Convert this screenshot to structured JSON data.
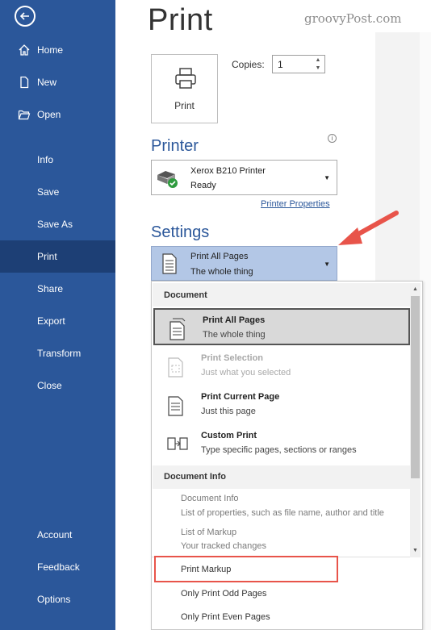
{
  "watermark": "groovyPost.com",
  "sidebar": {
    "top_items": [
      {
        "label": "Home",
        "icon": "home-icon"
      },
      {
        "label": "New",
        "icon": "new-document-icon"
      },
      {
        "label": "Open",
        "icon": "folder-open-icon"
      }
    ],
    "items": [
      {
        "label": "Info"
      },
      {
        "label": "Save"
      },
      {
        "label": "Save As"
      },
      {
        "label": "Print",
        "active": true
      },
      {
        "label": "Share"
      },
      {
        "label": "Export"
      },
      {
        "label": "Transform"
      },
      {
        "label": "Close"
      }
    ],
    "bottom_items": [
      {
        "label": "Account"
      },
      {
        "label": "Feedback"
      },
      {
        "label": "Options"
      }
    ]
  },
  "main": {
    "title": "Print",
    "print_button_label": "Print",
    "copies_label": "Copies:",
    "copies_value": "1",
    "printer_heading": "Printer",
    "printer_name": "Xerox B210 Printer",
    "printer_status": "Ready",
    "printer_properties_link": "Printer Properties",
    "settings_heading": "Settings",
    "settings_selected_title": "Print All Pages",
    "settings_selected_sub": "The whole thing"
  },
  "dropdown": {
    "document_header": "Document",
    "options": [
      {
        "title": "Print All Pages",
        "sub": "The whole thing",
        "state": "selected",
        "icon": "all-pages-icon"
      },
      {
        "title": "Print Selection",
        "sub": "Just what you selected",
        "state": "disabled",
        "icon": "selection-icon"
      },
      {
        "title": "Print Current Page",
        "sub": "Just this page",
        "state": "normal",
        "icon": "current-page-icon"
      },
      {
        "title": "Custom Print",
        "sub": "Type specific pages, sections or ranges",
        "state": "normal",
        "icon": "custom-print-icon"
      }
    ],
    "info_header": "Document Info",
    "info_items": [
      {
        "title": "Document Info",
        "sub": "List of properties, such as file name, author and title"
      },
      {
        "title": "List of Markup",
        "sub": "Your tracked changes"
      }
    ],
    "toggle_items": [
      "Print Markup",
      "Only Print Odd Pages",
      "Only Print Even Pages"
    ]
  },
  "colors": {
    "sidebar": "#2b579a",
    "sidebar_active": "#1d3f75",
    "accent_arrow": "#e8544a",
    "highlight_box": "#e8544a"
  }
}
